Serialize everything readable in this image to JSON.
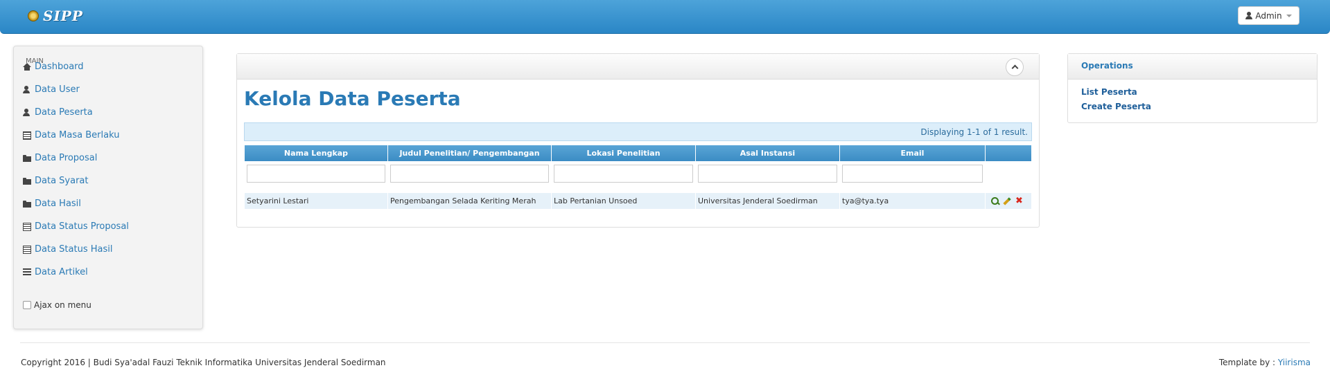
{
  "navbar": {
    "brand": "SIPP",
    "user_menu_label": "Admin"
  },
  "sidebar": {
    "heading": "MAIN",
    "items": [
      {
        "label": "Dashboard",
        "icon": "home-icon"
      },
      {
        "label": "Data User",
        "icon": "user-icon"
      },
      {
        "label": "Data Peserta",
        "icon": "user-icon"
      },
      {
        "label": "Data Masa Berlaku",
        "icon": "calendar-icon"
      },
      {
        "label": "Data Proposal",
        "icon": "folder-icon"
      },
      {
        "label": "Data Syarat",
        "icon": "folder-icon"
      },
      {
        "label": "Data Hasil",
        "icon": "folder-icon"
      },
      {
        "label": "Data Status Proposal",
        "icon": "list-icon"
      },
      {
        "label": "Data Status Hasil",
        "icon": "list-icon"
      },
      {
        "label": "Data Artikel",
        "icon": "align-icon"
      }
    ],
    "ajax_label": "Ajax on menu"
  },
  "main": {
    "title": "Kelola Data Peserta",
    "summary": "Displaying 1-1 of 1 result.",
    "columns": [
      "Nama Lengkap",
      "Judul Penelitian/ Pengembangan",
      "Lokasi Penelitian",
      "Asal Instansi",
      "Email"
    ],
    "filters": [
      "",
      "",
      "",
      "",
      ""
    ],
    "rows": [
      [
        "Setyarini Lestari",
        "Pengembangan Selada Keriting Merah",
        "Lab Pertanian Unsoed",
        "Universitas Jenderal Soedirman",
        "tya@tya.tya"
      ]
    ]
  },
  "operations": {
    "title": "Operations",
    "links": [
      "List Peserta",
      "Create Peserta"
    ]
  },
  "footer": {
    "copyright": "Copyright 2016 | Budi Sya'adal Fauzi Teknik Informatika Universitas Jenderal Soedirman",
    "template_prefix": "Template by :",
    "template_link": "Yiirisma"
  }
}
